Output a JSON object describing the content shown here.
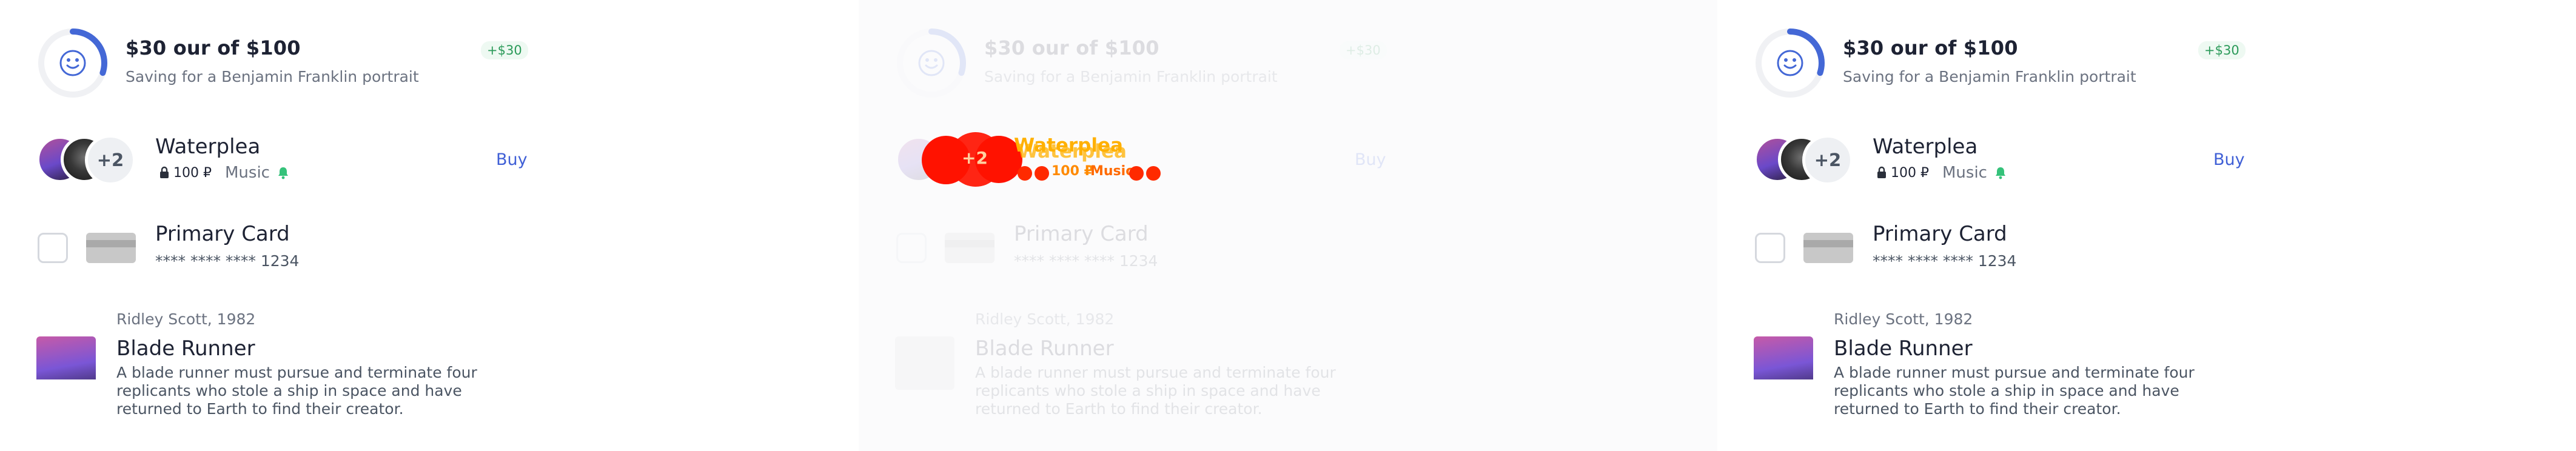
{
  "savings": {
    "title": "$30 our of $100",
    "subtitle": "Saving for a Benjamin Franklin portrait",
    "delta": "+$30",
    "progress": 0.3,
    "accent": "#4468d6",
    "face_icon": "smile-icon"
  },
  "subscription": {
    "title": "Waterplea",
    "price": "100 ₽",
    "genre": "Music",
    "more_count": "+2",
    "buy_label": "Buy",
    "icons": [
      "lock-icon",
      "bell-icon"
    ]
  },
  "payment": {
    "title": "Primary Card",
    "number": "**** **** **** 1234"
  },
  "movie": {
    "meta": "Ridley Scott, 1982",
    "title": "Blade Runner",
    "description": "A blade runner must pursue and terminate four replicants who stole a ship in space and have returned to Earth to find their creator."
  },
  "colors": {
    "delta_bg": "#eef9f2",
    "delta_fg": "#2b9a59",
    "link": "#3f5fd6",
    "overlay_red": "#ff1200",
    "overlay_text": "#ffb000"
  }
}
